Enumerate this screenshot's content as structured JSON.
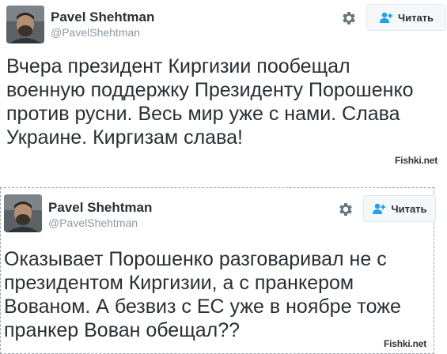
{
  "tweets": [
    {
      "author_name": "Pavel Shehtman",
      "author_handle": "@PavelShehtman",
      "follow_label": "Читать",
      "lines": [
        "Вчера президент Киргизии пообещал",
        "военную поддержку Президенту Порошенко",
        "против русни. Весь мир уже с нами. Слава",
        "Украине. Киргизам слава!"
      ],
      "watermark": "Fishki.net",
      "icons": {
        "avatar": "avatar-photo",
        "settings": "gear-icon",
        "follow": "add-user-icon"
      }
    },
    {
      "author_name": "Pavel Shehtman",
      "author_handle": "@PavelShehtman",
      "follow_label": "Читать",
      "lines": [
        "Оказывает Порошенко разговаривал не с",
        "президентом Киргизии, а с пранкером",
        "Вованом. А безвиз с ЕС уже в ноябре тоже",
        "пранкер Вован обещал??"
      ],
      "watermark": "Fishki.net",
      "icons": {
        "avatar": "avatar-photo",
        "settings": "gear-icon",
        "follow": "add-user-icon"
      }
    }
  ],
  "colors": {
    "text": "#292f33",
    "handle": "#8899a6",
    "icon": "#66757f",
    "follow_icon": "#1da1f2"
  }
}
